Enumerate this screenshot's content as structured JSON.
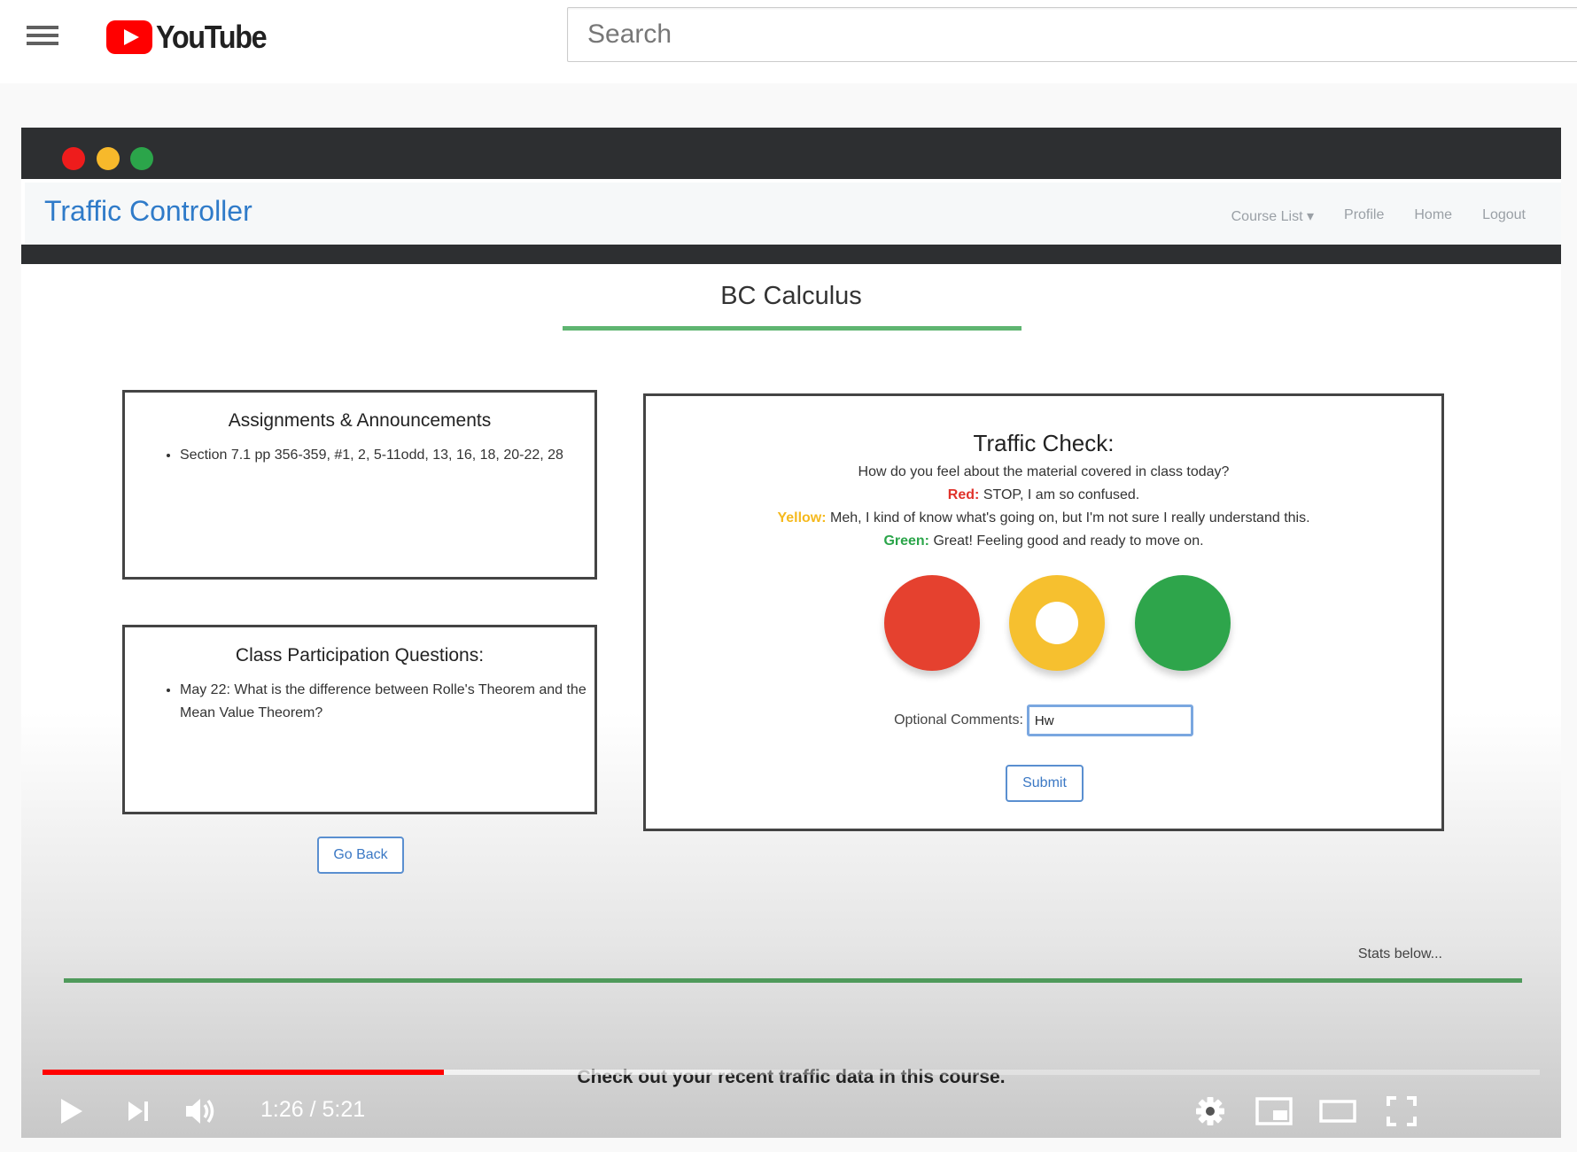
{
  "masthead": {
    "logo_text": "YouTube",
    "search_placeholder": "Search"
  },
  "video": {
    "app": {
      "brand": "Traffic Controller",
      "nav": [
        "Course List ▾",
        "Profile",
        "Home",
        "Logout"
      ]
    },
    "page_title": "BC Calculus",
    "assignments": {
      "title": "Assignments & Announcements",
      "items": [
        "Section 7.1 pp 356-359, #1, 2, 5-11odd, 13, 16, 18, 20-22, 28"
      ]
    },
    "questions": {
      "title": "Class Participation Questions:",
      "items": [
        "May 22: What is the difference between Rolle's Theorem and the Mean Value Theorem?"
      ]
    },
    "go_back_label": "Go Back",
    "traffic_check": {
      "title": "Traffic Check:",
      "prompt": "How do you feel about the material covered in class today?",
      "red_label": "Red:",
      "red_text": "STOP, I am so confused.",
      "yellow_label": "Yellow:",
      "yellow_text": "Meh, I kind of know what's going on, but I'm not sure I really understand this.",
      "green_label": "Green:",
      "green_text": "Great! Feeling good and ready to move on.",
      "comments_label": "Optional Comments:",
      "comments_value": "Hw",
      "submit_label": "Submit"
    },
    "stats_text": "Stats below...",
    "overlay_text": "Check out your recent traffic data in this course."
  },
  "player": {
    "current_time": "1:26",
    "duration": "5:21",
    "time_display": "1:26 / 5:21",
    "progress_fraction": 0.268,
    "buffered_fraction": 0.46,
    "accent_color": "#ff0000"
  }
}
